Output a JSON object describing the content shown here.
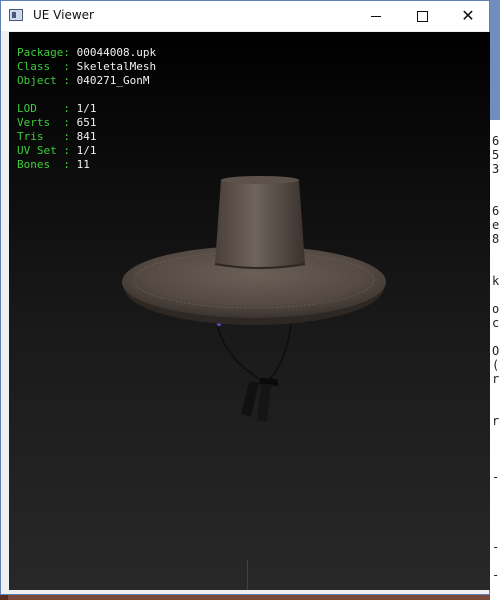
{
  "window": {
    "title": "UE Viewer",
    "controls": {
      "minimize": "minimize",
      "maximize": "maximize",
      "close": "✕"
    }
  },
  "info": {
    "package_key": "Package: ",
    "package": "00044008.upk",
    "class_key": "Class  : ",
    "class": "SkeletalMesh",
    "object_key": "Object : ",
    "object": "040271_GonM",
    "lod_key": "LOD    : ",
    "lod": "1/1",
    "verts_key": "Verts  : ",
    "verts": "651",
    "tris_key": "Tris   : ",
    "tris": "841",
    "uvset_key": "UV Set : ",
    "uvset": "1/1",
    "bones_key": "Bones  : ",
    "bones": "11"
  },
  "background_window": {
    "glyphs": "6\n5\n3\n\n\n6\ne\n8\n\n\nk\n\no\nc\n\nO\n(\nr\n\n\nr\n\n\n\n-\n\n\n\n\n-\n\n-"
  },
  "colors": {
    "key": "#3dcd3d",
    "value": "#f2f2f2",
    "window_border": "#5e7fb5",
    "axis": "#2a2aff"
  }
}
